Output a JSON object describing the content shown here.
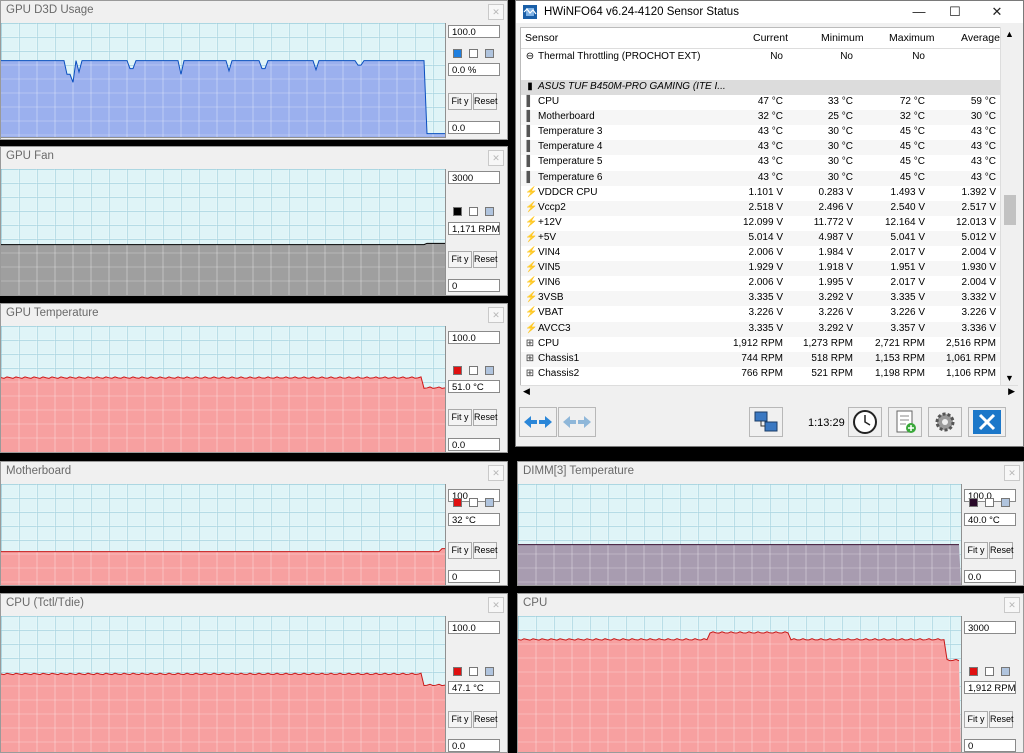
{
  "graphs": [
    {
      "id": "gpu-d3d",
      "title": "GPU D3D Usage",
      "max": "100.0",
      "current": "0.0 %",
      "min": "0.0",
      "fit": "Fit y",
      "reset": "Reset",
      "line_color": "#0a4fbf",
      "fill_color": "#9bb0ee",
      "swatch_color": "#1e7fe0"
    },
    {
      "id": "gpu-fan",
      "title": "GPU Fan",
      "max": "3000",
      "current": "1,171 RPM",
      "min": "0",
      "fit": "Fit y",
      "reset": "Reset",
      "line_color": "#000000",
      "fill_color": "#9f9f9f",
      "swatch_color": "#000000"
    },
    {
      "id": "gpu-temp",
      "title": "GPU Temperature",
      "max": "100.0",
      "current": "51.0 °C",
      "min": "0.0",
      "fit": "Fit y",
      "reset": "Reset",
      "line_color": "#d01818",
      "fill_color": "#f7a0a0",
      "swatch_color": "#e01010"
    },
    {
      "id": "motherboard",
      "title": "Motherboard",
      "max": "100",
      "current": "32 °C",
      "min": "0",
      "fit": "Fit y",
      "reset": "Reset",
      "line_color": "#c81818",
      "fill_color": "#f7a0a0",
      "swatch_color": "#e01010"
    },
    {
      "id": "cpu-tctl",
      "title": "CPU (Tctl/Tdie)",
      "max": "100.0",
      "current": "47.1 °C",
      "min": "0.0",
      "fit": "Fit y",
      "reset": "Reset",
      "line_color": "#c81818",
      "fill_color": "#f7a0a0",
      "swatch_color": "#e01010"
    },
    {
      "id": "dimm3",
      "title": "DIMM[3] Temperature",
      "max": "100.0",
      "current": "40.0 °C",
      "min": "0.0",
      "fit": "Fit y",
      "reset": "Reset",
      "line_color": "#3a1030",
      "fill_color": "#a89cb0",
      "swatch_color": "#2a0a2a"
    },
    {
      "id": "cpu-fan",
      "title": "CPU",
      "max": "3000",
      "current": "1,912 RPM",
      "min": "0",
      "fit": "Fit y",
      "reset": "Reset",
      "line_color": "#c81818",
      "fill_color": "#f7a0a0",
      "swatch_color": "#e01010"
    }
  ],
  "hwinfo": {
    "title": "HWiNFO64 v6.24-4120 Sensor Status",
    "columns": [
      "Sensor",
      "Current",
      "Minimum",
      "Maximum",
      "Average"
    ],
    "top_row": {
      "name": "Thermal Throttling (PROCHOT EXT)",
      "current": "No",
      "minimum": "No",
      "maximum": "No",
      "average": ""
    },
    "group": "ASUS TUF B450M-PRO GAMING (ITE I...",
    "rows": [
      {
        "icon": "thermometer-icon",
        "name": "CPU",
        "current": "47 °C",
        "minimum": "33 °C",
        "maximum": "72 °C",
        "average": "59 °C"
      },
      {
        "icon": "thermometer-icon",
        "name": "Motherboard",
        "current": "32 °C",
        "minimum": "25 °C",
        "maximum": "32 °C",
        "average": "30 °C"
      },
      {
        "icon": "thermometer-icon",
        "name": "Temperature 3",
        "current": "43 °C",
        "minimum": "30 °C",
        "maximum": "45 °C",
        "average": "43 °C"
      },
      {
        "icon": "thermometer-icon",
        "name": "Temperature 4",
        "current": "43 °C",
        "minimum": "30 °C",
        "maximum": "45 °C",
        "average": "43 °C"
      },
      {
        "icon": "thermometer-icon",
        "name": "Temperature 5",
        "current": "43 °C",
        "minimum": "30 °C",
        "maximum": "45 °C",
        "average": "43 °C"
      },
      {
        "icon": "thermometer-icon",
        "name": "Temperature 6",
        "current": "43 °C",
        "minimum": "30 °C",
        "maximum": "45 °C",
        "average": "43 °C"
      },
      {
        "icon": "lightning-icon",
        "name": "VDDCR CPU",
        "current": "1.101 V",
        "minimum": "0.283 V",
        "maximum": "1.493 V",
        "average": "1.392 V"
      },
      {
        "icon": "lightning-icon",
        "name": "Vccp2",
        "current": "2.518 V",
        "minimum": "2.496 V",
        "maximum": "2.540 V",
        "average": "2.517 V"
      },
      {
        "icon": "lightning-icon",
        "name": "+12V",
        "current": "12.099 V",
        "minimum": "11.772 V",
        "maximum": "12.164 V",
        "average": "12.013 V"
      },
      {
        "icon": "lightning-icon",
        "name": "+5V",
        "current": "5.014 V",
        "minimum": "4.987 V",
        "maximum": "5.041 V",
        "average": "5.012 V"
      },
      {
        "icon": "lightning-icon",
        "name": "VIN4",
        "current": "2.006 V",
        "minimum": "1.984 V",
        "maximum": "2.017 V",
        "average": "2.004 V"
      },
      {
        "icon": "lightning-icon",
        "name": "VIN5",
        "current": "1.929 V",
        "minimum": "1.918 V",
        "maximum": "1.951 V",
        "average": "1.930 V"
      },
      {
        "icon": "lightning-icon",
        "name": "VIN6",
        "current": "2.006 V",
        "minimum": "1.995 V",
        "maximum": "2.017 V",
        "average": "2.004 V"
      },
      {
        "icon": "lightning-icon",
        "name": "3VSB",
        "current": "3.335 V",
        "minimum": "3.292 V",
        "maximum": "3.335 V",
        "average": "3.332 V"
      },
      {
        "icon": "lightning-icon",
        "name": "VBAT",
        "current": "3.226 V",
        "minimum": "3.226 V",
        "maximum": "3.226 V",
        "average": "3.226 V"
      },
      {
        "icon": "lightning-icon",
        "name": "AVCC3",
        "current": "3.335 V",
        "minimum": "3.292 V",
        "maximum": "3.357 V",
        "average": "3.336 V"
      },
      {
        "icon": "fan-icon",
        "name": "CPU",
        "current": "1,912 RPM",
        "minimum": "1,273 RPM",
        "maximum": "2,721 RPM",
        "average": "2,516 RPM"
      },
      {
        "icon": "fan-icon",
        "name": "Chassis1",
        "current": "744 RPM",
        "minimum": "518 RPM",
        "maximum": "1,153 RPM",
        "average": "1,061 RPM"
      },
      {
        "icon": "fan-icon",
        "name": "Chassis2",
        "current": "766 RPM",
        "minimum": "521 RPM",
        "maximum": "1,198 RPM",
        "average": "1,106 RPM"
      }
    ],
    "elapsed": "1:13:29"
  }
}
